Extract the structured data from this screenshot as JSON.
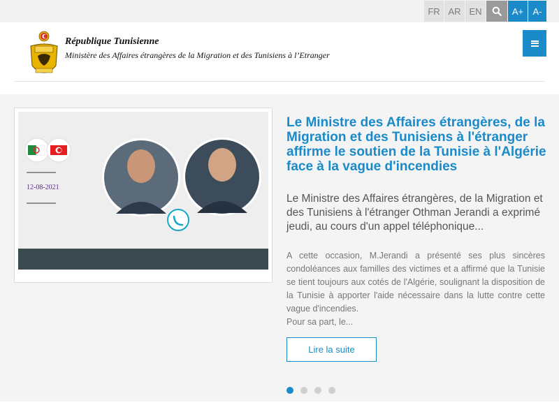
{
  "topbar": {
    "languages": [
      "FR",
      "AR",
      "EN"
    ],
    "search_icon": "search-icon",
    "font_increase": "A+",
    "font_decrease": "A-"
  },
  "header": {
    "title": "République Tunisienne",
    "subtitle": "Ministère des Affaires étrangères de la Migration et des Tunisiens à l’Etranger",
    "menu_icon": "hamburger-menu-icon"
  },
  "slide": {
    "image_date": "12-08-2021",
    "title": "Le Ministre des Affaires étrangères, de la Migration et des Tunisiens à l'étranger affirme le soutien de la Tunisie à l'Algérie face à la vague d'incendies",
    "lead": "Le Ministre des Affaires étrangères, de la Migration et des Tunisiens à l'étranger Othman Jerandi a exprimé jeudi, au cours d'un appel téléphonique...",
    "body": "A cette occasion, M.Jerandi a présenté ses plus sincères condoléances aux familles des victimes et  a affirmé que la Tunisie se tient toujours aux cotés de l'Algérie, soulignant la disposition de la Tunisie à apporter l'aide nécessaire dans la lutte contre cette vague d'incendies.",
    "body_more": "Pour sa part, le...",
    "read_more": "Lire la suite"
  },
  "carousel": {
    "total_slides": 4,
    "active_slide": 1
  },
  "colors": {
    "accent": "#1a8ac9",
    "section_bg": "#f4f4f4"
  }
}
